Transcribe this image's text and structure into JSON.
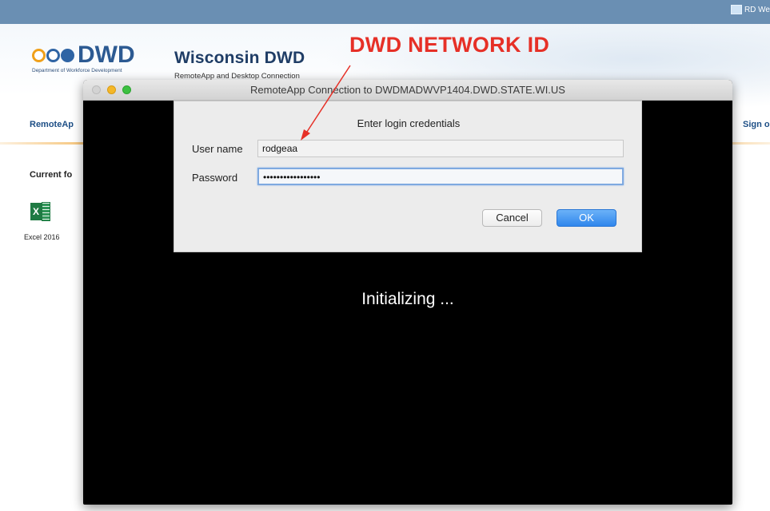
{
  "browser": {
    "rdweb_label": "RD We"
  },
  "page": {
    "logo_text": "DWD",
    "logo_subtitle": "Department of Workforce Development",
    "site_title": "Wisconsin DWD",
    "site_subtitle": "RemoteApp and Desktop Connection",
    "nav_left": "RemoteAp",
    "nav_right": "Sign o",
    "current_folder_label": "Current fo",
    "apps": [
      {
        "label": "Excel 2016",
        "icon": "excel-icon"
      }
    ]
  },
  "annotation": {
    "text": "DWD NETWORK ID",
    "color": "#e63027"
  },
  "window": {
    "title": "RemoteApp Connection to DWDMADWVP1404.DWD.STATE.WI.US",
    "status": "Initializing ..."
  },
  "login": {
    "heading": "Enter login credentials",
    "user_label": "User name",
    "user_value": "rodgeaa",
    "password_label": "Password",
    "password_value": "•••••••••••••••••",
    "cancel_label": "Cancel",
    "ok_label": "OK"
  },
  "colors": {
    "accent_blue": "#2f86ec",
    "brand_blue": "#2c5a92",
    "brand_orange": "#f0a028"
  }
}
